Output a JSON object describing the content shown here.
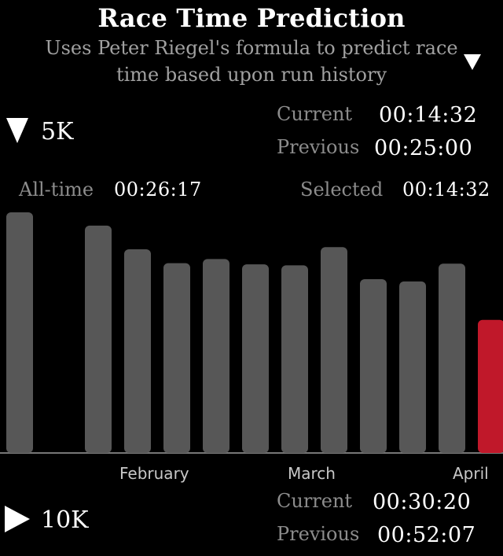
{
  "header": {
    "title": "Race Time Prediction",
    "subtitle": "Uses Peter Riegel's formula  to predict race time based upon run history"
  },
  "sections": [
    {
      "label": "5K",
      "expanded": true,
      "current_label": "Current",
      "current_value": "00:14:32",
      "previous_label": "Previous",
      "previous_value": "00:25:00",
      "alltime_label": "All-time",
      "alltime_value": "00:26:17",
      "selected_label": "Selected",
      "selected_value": "00:14:32"
    },
    {
      "label": "10K",
      "expanded": false,
      "current_label": "Current",
      "current_value": "00:30:20",
      "previous_label": "Previous",
      "previous_value": "00:52:07"
    }
  ],
  "chart_data": {
    "type": "bar",
    "x_labels": [
      "February",
      "March",
      "April"
    ],
    "values_seconds": [
      1577,
      null,
      1490,
      1335,
      1244,
      1271,
      1236,
      1230,
      1349,
      1139,
      1124,
      1241,
      872
    ],
    "selected_index": 12,
    "colors": {
      "bar": "#575757",
      "selected": "#c0182a",
      "baseline": "#777777"
    },
    "ylim": [
      0,
      1577
    ]
  }
}
